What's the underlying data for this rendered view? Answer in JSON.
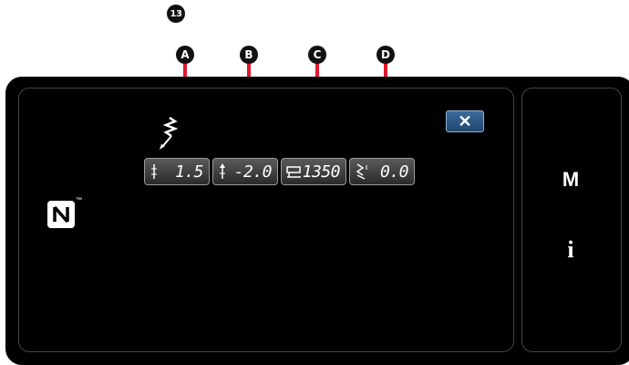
{
  "callouts": {
    "item13": "13",
    "a": "A",
    "b": "B",
    "c": "C",
    "d": "D"
  },
  "toolbar": {
    "close_symbol": "✕"
  },
  "params": [
    {
      "label": "stitch-length",
      "value": "1.5"
    },
    {
      "label": "reverse-feed",
      "value": "-2.0"
    },
    {
      "label": "sewing-speed",
      "value": "1350"
    },
    {
      "label": "presser-foot",
      "value": "0.0"
    }
  ],
  "side_panel": {
    "mode_label": "M",
    "info_label": "i"
  },
  "nfc": {
    "trademark": "™"
  },
  "colors": {
    "callout_line": "#e0182d",
    "close_button": "#2d5a86",
    "screen_bg": "#000000"
  }
}
